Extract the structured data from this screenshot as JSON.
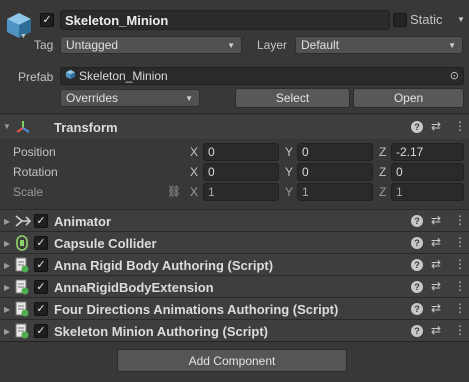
{
  "header": {
    "object_name": "Skeleton_Minion",
    "active": true,
    "static_label": "Static",
    "static_checked": false,
    "tag_label": "Tag",
    "tag_value": "Untagged",
    "layer_label": "Layer",
    "layer_value": "Default"
  },
  "prefab": {
    "label": "Prefab",
    "asset_name": "Skeleton_Minion",
    "overrides_label": "Overrides",
    "select_label": "Select",
    "open_label": "Open"
  },
  "transform": {
    "title": "Transform",
    "rows": [
      {
        "label": "Position",
        "x": "0",
        "y": "0",
        "z": "-2.17"
      },
      {
        "label": "Rotation",
        "x": "0",
        "y": "0",
        "z": "0"
      },
      {
        "label": "Scale",
        "x": "1",
        "y": "1",
        "z": "1"
      }
    ],
    "axis_x": "X",
    "axis_y": "Y",
    "axis_z": "Z"
  },
  "components": [
    {
      "name": "Animator",
      "icon": "animator-icon",
      "enabled": true
    },
    {
      "name": "Capsule Collider",
      "icon": "capsule-collider-icon",
      "enabled": true
    },
    {
      "name": "Anna Rigid Body Authoring (Script)",
      "icon": "script-icon",
      "enabled": true
    },
    {
      "name": "AnnaRigidBodyExtension",
      "icon": "script-icon",
      "enabled": true
    },
    {
      "name": "Four Directions Animations Authoring (Script)",
      "icon": "script-icon",
      "enabled": true
    },
    {
      "name": "Skeleton Minion Authoring (Script)",
      "icon": "script-icon",
      "enabled": true
    }
  ],
  "add_component_label": "Add Component",
  "icons": {
    "game_object": "cube-icon",
    "help": "help-icon",
    "presets": "sliders-icon",
    "menu": "kebab-menu-icon",
    "scale_link": "unlinked-chain-icon",
    "target": "target-icon"
  },
  "colors": {
    "background": "#383838",
    "component_header": "#3e3e3e",
    "field": "#2a2a2a",
    "button": "#585858"
  }
}
